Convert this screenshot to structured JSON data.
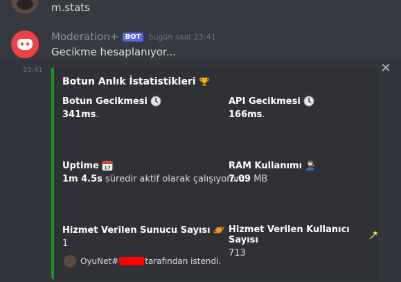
{
  "previous_message": {
    "text": "m.stats"
  },
  "bot_message": {
    "author": "Moderation+",
    "badge": "BOT",
    "timestamp": "bugün saat 23:41",
    "text": "Gecikme hesaplanıyor...",
    "side_time": "23:41"
  },
  "embed": {
    "accent_color": "#179a1f",
    "title": "Botun Anlık İstatistikleri",
    "fields": [
      {
        "name": "Botun Gecikmesi",
        "value_bold": "341ms",
        "value_rest": ".",
        "icon": "clock-icon"
      },
      {
        "name": "API Gecikmesi",
        "value_bold": "166ms",
        "value_rest": ".",
        "icon": "clock-icon"
      },
      {
        "name": "Uptime",
        "value_bold": "1m 4.5s",
        "value_rest": " süredir aktif olarak çalışıyorum.",
        "icon": "calendar-icon"
      },
      {
        "name": "RAM Kullanımı",
        "value_bold": "7.09",
        "value_rest": " MB",
        "icon": "mechanic-icon"
      },
      {
        "name": "Hizmet Verilen Sunucu Sayısı",
        "value_bold": "",
        "value_rest": "1",
        "icon": "planet-icon"
      },
      {
        "name": "Hizmet Verilen Kullanıcı Sayısı",
        "value_bold": "",
        "value_rest": "713",
        "icon": "dizzy-star-icon"
      }
    ],
    "footer": {
      "prefix": "OyuNet#",
      "suffix": "tarafından istendi."
    }
  }
}
